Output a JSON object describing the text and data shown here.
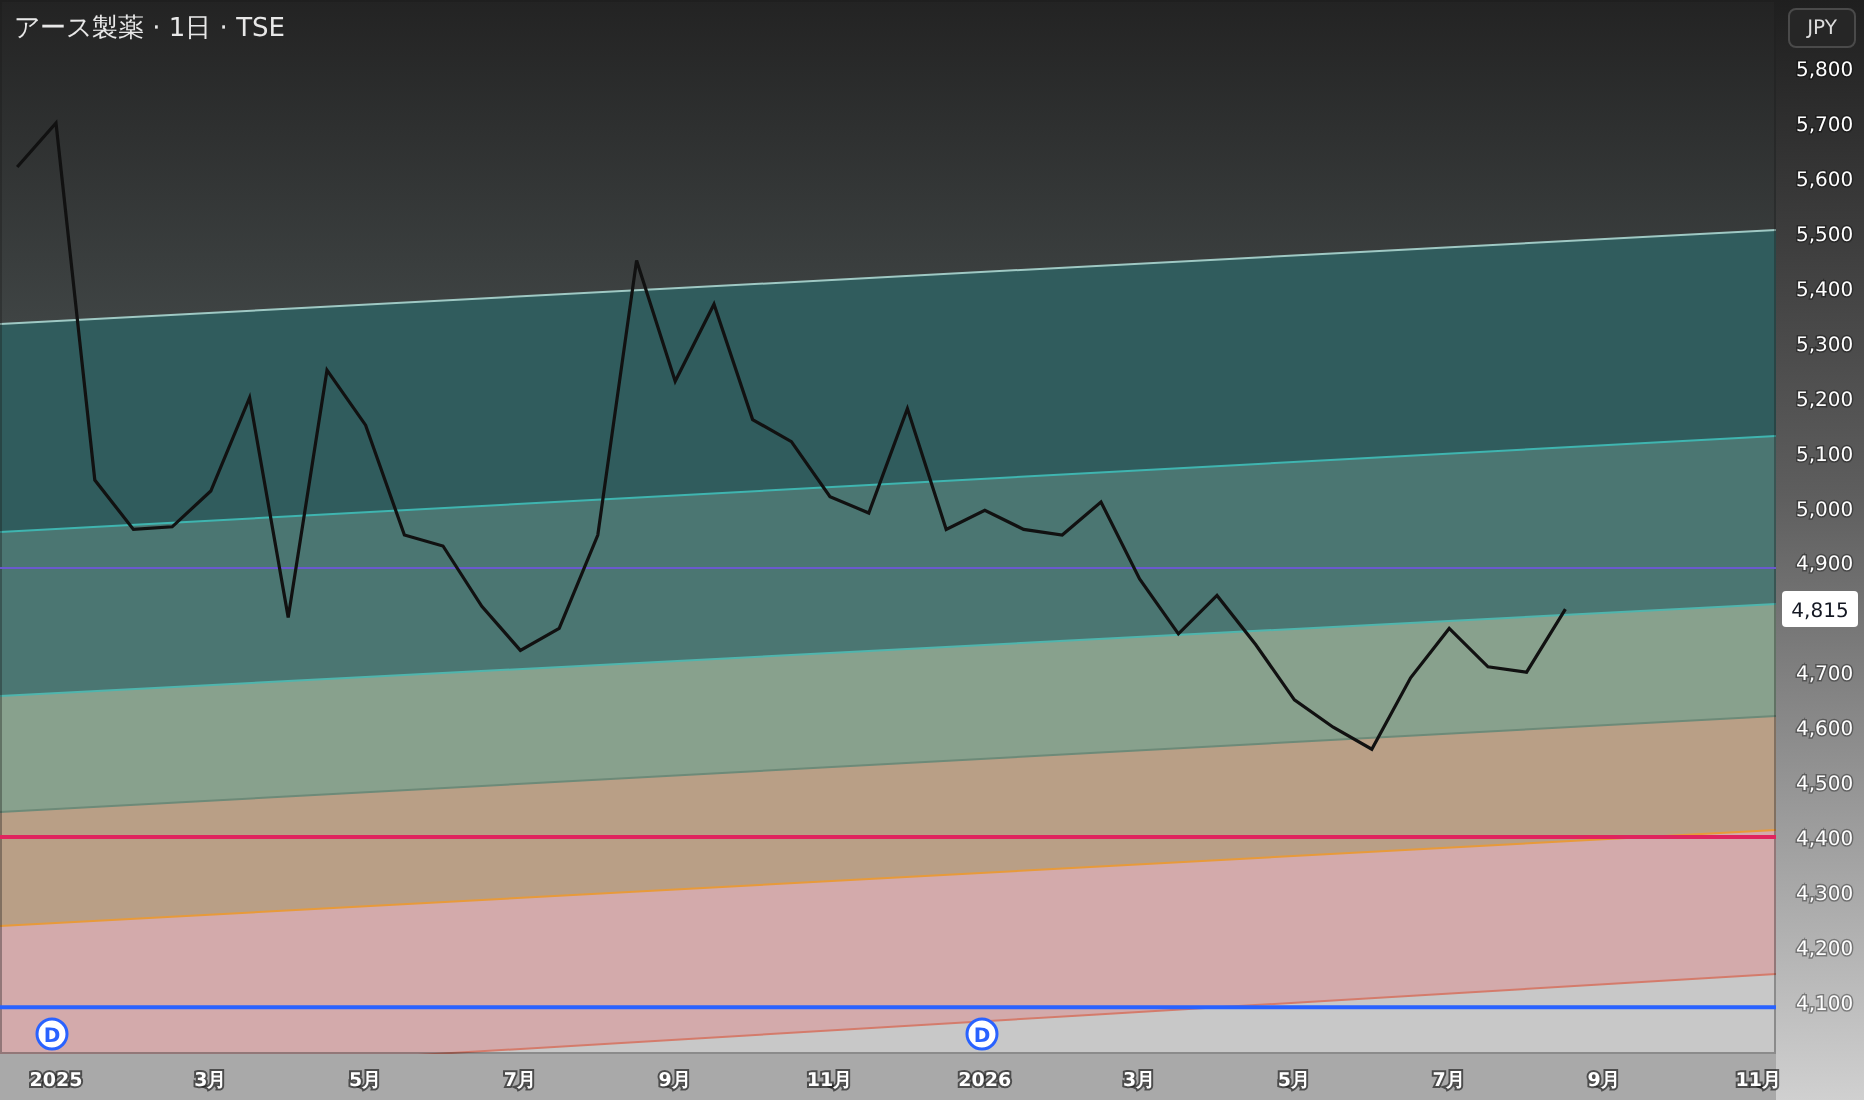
{
  "title": "アース製薬 · 1日 · TSE",
  "currency_button": "JPY",
  "last_price": "4,815",
  "chart_data": {
    "type": "line",
    "categories": [
      null,
      "2025",
      null,
      null,
      null,
      "3月",
      null,
      null,
      null,
      "5月",
      null,
      null,
      null,
      "7月",
      null,
      null,
      null,
      "9月",
      null,
      null,
      null,
      "11月",
      null,
      null,
      null,
      "2026",
      null,
      null,
      null,
      "3月",
      null,
      null,
      null,
      "5月",
      null,
      null,
      null,
      "7月",
      null,
      null,
      null,
      "9月",
      null,
      null,
      null,
      "11月"
    ],
    "series": [
      {
        "color": "#111111",
        "values": [
          5620,
          5700,
          5050,
          4960,
          4965,
          5030,
          5200,
          4800,
          5250,
          5150,
          4950,
          4930,
          4820,
          4740,
          4780,
          4950,
          5450,
          5230,
          5370,
          5160,
          5120,
          5020,
          4990,
          5180,
          4960,
          4995,
          4960,
          4950,
          5010,
          4870,
          4770,
          4840,
          4750,
          4650,
          4600,
          4560,
          4690,
          4780,
          4710,
          4700,
          4815,
          null,
          null,
          null,
          null,
          null
        ]
      }
    ],
    "yticks": [
      {
        "value": 5800,
        "label": "5,800"
      },
      {
        "value": 5700,
        "label": "5,700"
      },
      {
        "value": 5600,
        "label": "5,600"
      },
      {
        "value": 5500,
        "label": "5,500"
      },
      {
        "value": 5400,
        "label": "5,400"
      },
      {
        "value": 5300,
        "label": "5,300"
      },
      {
        "value": 5200,
        "label": "5,200"
      },
      {
        "value": 5100,
        "label": "5,100"
      },
      {
        "value": 5000,
        "label": "5,000"
      },
      {
        "value": 4900,
        "label": "4,900"
      },
      {
        "value": 4700,
        "label": "4,700"
      },
      {
        "value": 4600,
        "label": "4,600"
      },
      {
        "value": 4500,
        "label": "4,500"
      },
      {
        "value": 4400,
        "label": "4,400"
      },
      {
        "value": 4300,
        "label": "4,300"
      },
      {
        "value": 4200,
        "label": "4,200"
      },
      {
        "value": 4100,
        "label": "4,100"
      }
    ],
    "ylim": [
      4005,
      5924
    ],
    "ref_lines": [
      {
        "axis": "y",
        "value": 4890,
        "color": "#6a5acd"
      },
      {
        "axis": "y",
        "value": 4400,
        "color": "#e0245e"
      },
      {
        "axis": "y",
        "value": 4090,
        "color": "#2962ff"
      }
    ]
  },
  "dividend_markers": [
    "D",
    "D"
  ]
}
